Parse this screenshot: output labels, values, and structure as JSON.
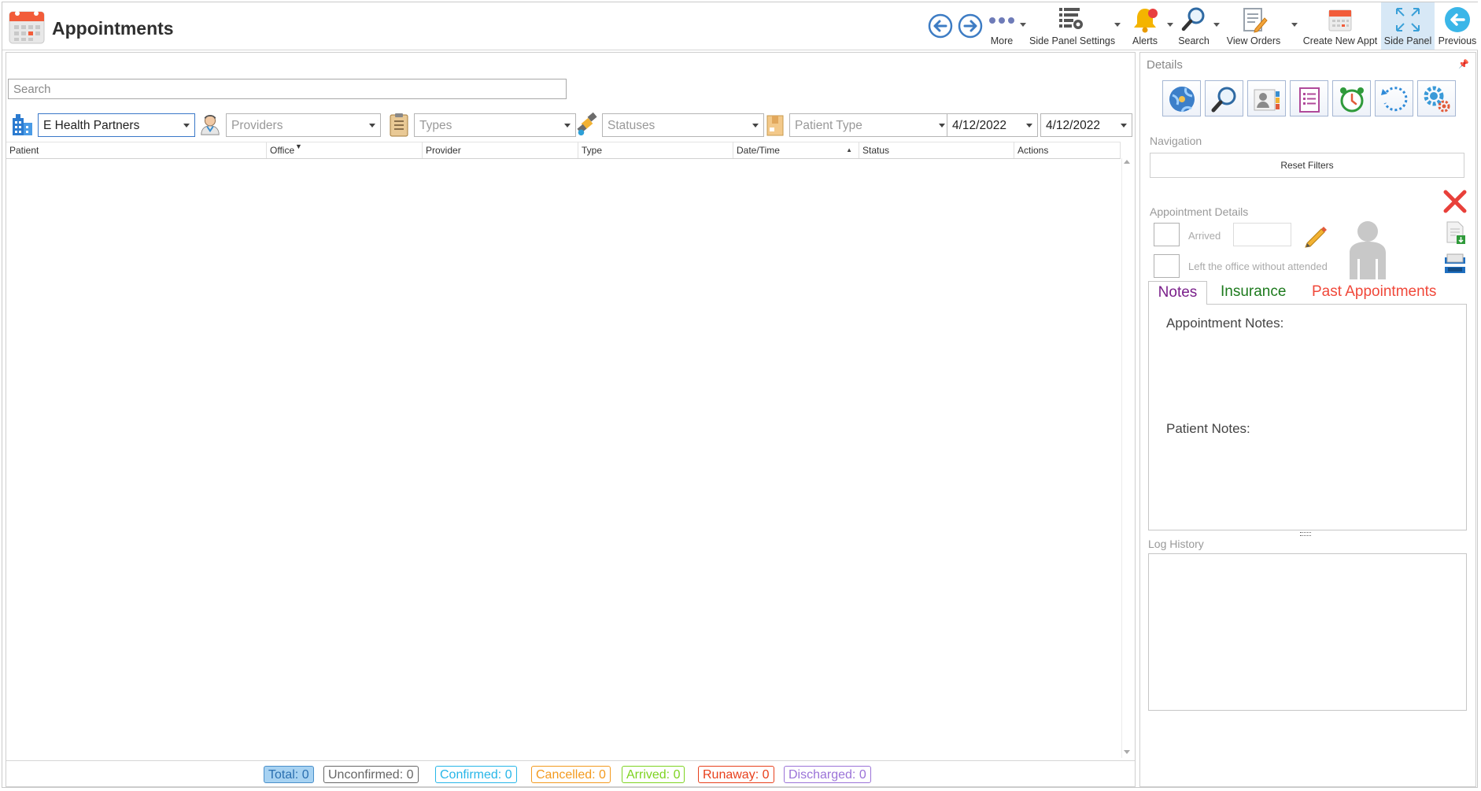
{
  "app": {
    "title": "Appointments"
  },
  "toolbar": {
    "more": "More",
    "side_panel_settings": "Side Panel Settings",
    "alerts": "Alerts",
    "search": "Search",
    "view_orders": "View Orders",
    "create_new_appt": "Create New Appt",
    "side_panel": "Side Panel",
    "previous": "Previous"
  },
  "search": {
    "placeholder": "Search"
  },
  "filters": {
    "office": "E Health Partners",
    "providers_placeholder": "Providers",
    "types_placeholder": "Types",
    "statuses_placeholder": "Statuses",
    "patient_type_placeholder": "Patient Type",
    "date_from": "4/12/2022",
    "date_to": "4/12/2022"
  },
  "grid": {
    "columns": [
      "Patient",
      "Office",
      "Provider",
      "Type",
      "Date/Time",
      "Status",
      "Actions"
    ],
    "rows": []
  },
  "status_counts": [
    {
      "label": "Total: 0",
      "color": "#4a8fc9"
    },
    {
      "label": "Unconfirmed: 0",
      "color": "#666666"
    },
    {
      "label": "Confirmed: 0",
      "color": "#27b6e8"
    },
    {
      "label": "Cancelled: 0",
      "color": "#f39a1e"
    },
    {
      "label": "Arrived: 0",
      "color": "#7ed321"
    },
    {
      "label": "Runaway: 0",
      "color": "#e8401c"
    },
    {
      "label": "Discharged: 0",
      "color": "#9b73d8"
    }
  ],
  "side_panel": {
    "title": "Details",
    "navigation_label": "Navigation",
    "reset_filters": "Reset Filters",
    "appointment_details_label": "Appointment Details",
    "arrived_label": "Arrived",
    "left_office_label": "Left the office without attended",
    "tabs": {
      "notes": "Notes",
      "insurance": "Insurance",
      "past_appointments": "Past Appointments"
    },
    "tab_colors": {
      "notes": "#7a1f8a",
      "insurance": "#1d7a1d",
      "past_appointments": "#f0483a"
    },
    "appointment_notes_label": "Appointment Notes:",
    "patient_notes_label": "Patient Notes:",
    "log_history_label": "Log History"
  },
  "icons": [
    "calendar-icon",
    "back-icon",
    "forward-icon",
    "more-icon",
    "side-panel-settings-icon",
    "bell-icon",
    "search-icon",
    "view-orders-icon",
    "calendar-new-icon",
    "expand-icon",
    "previous-icon",
    "building-icon",
    "provider-icon",
    "clipboard-icon",
    "satellite-icon",
    "box-icon",
    "globe-icon",
    "magnifier-icon",
    "contact-card-icon",
    "checklist-icon",
    "alarm-clock-icon",
    "refresh-icon",
    "gears-icon",
    "close-icon",
    "pencil-icon",
    "export-doc-icon",
    "inbox-icon",
    "person-icon",
    "pin-icon"
  ]
}
